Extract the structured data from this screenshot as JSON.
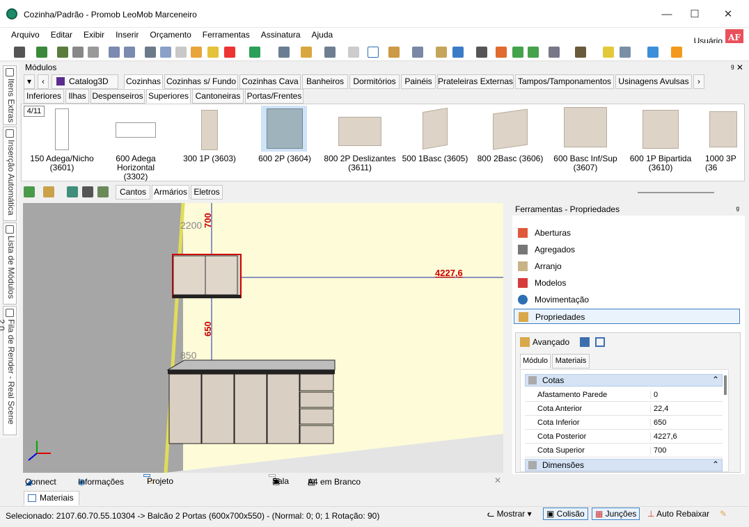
{
  "window": {
    "title": "Cozinha/Padrão - Promob LeoMob Marceneiro",
    "minimize": "—",
    "maximize": "☐",
    "close": "✕"
  },
  "menu": [
    "Arquivo",
    "Editar",
    "Exibir",
    "Inserir",
    "Orçamento",
    "Ferramentas",
    "Assinatura",
    "Ajuda"
  ],
  "user": {
    "label": "Usuário",
    "initials": "AF"
  },
  "left_tabs": [
    "Itens Extras",
    "Inserção Automática",
    "Lista de Módulos",
    "Fila de Render - Real Scene 2.0"
  ],
  "modules_panel": {
    "title": "Módulos",
    "pin": "ᵍ ✕"
  },
  "catalog": {
    "label": "Catalog3D",
    "nav_down": "▾",
    "nav_left": "‹",
    "nav_right": "›"
  },
  "tabs_row1": [
    "Cozinhas",
    "Cozinhas s/ Fundo",
    "Cozinhas Cava",
    "Banheiros",
    "Dormitórios",
    "Painéis",
    "Prateleiras Externas",
    "Tampos/Tamponamentos",
    "Usinagens Avulsas"
  ],
  "tabs_row2": [
    "Inferiores",
    "Ilhas",
    "Despenseiros",
    "Superiores",
    "Cantoneiras",
    "Portas/Frentes"
  ],
  "gallery": {
    "page": "4/11",
    "items": [
      {
        "line1": "150 Adega/Nicho",
        "line2": "(3601)"
      },
      {
        "line1": "600 Adega Horizontal",
        "line2": "(3302)"
      },
      {
        "line1": "300 1P (3603)",
        "line2": ""
      },
      {
        "line1": "600 2P (3604)",
        "line2": ""
      },
      {
        "line1": "800 2P Deslizantes",
        "line2": "(3611)"
      },
      {
        "line1": "500 1Basc (3605)",
        "line2": ""
      },
      {
        "line1": "800 2Basc (3606)",
        "line2": ""
      },
      {
        "line1": "600 Basc Inf/Sup",
        "line2": "(3607)"
      },
      {
        "line1": "600 1P Bipartida",
        "line2": "(3610)"
      },
      {
        "line1": "1000 3P (36",
        "line2": ""
      }
    ]
  },
  "view_tabs": [
    "Cantos",
    "Armários",
    "Eletros"
  ],
  "viewport": {
    "dims": {
      "a": "2200",
      "b": "700",
      "c": "4227,6",
      "d": "650",
      "e": "850"
    }
  },
  "tools_panel": {
    "title": "Ferramentas - Propriedades",
    "pin": "ᵍ",
    "items": [
      "Aberturas",
      "Agregados",
      "Arranjo",
      "Modelos",
      "Movimentação",
      "Propriedades"
    ],
    "advanced": "Avançado",
    "subtabs": [
      "Módulo",
      "Materiais"
    ],
    "cotas": {
      "title": "Cotas",
      "rows": [
        [
          "Afastamento Parede",
          "0"
        ],
        [
          "Cota Anterior",
          "22,4"
        ],
        [
          "Cota Inferior",
          "650"
        ],
        [
          "Cota Posterior",
          "4227,6"
        ],
        [
          "Cota Superior",
          "700"
        ]
      ]
    },
    "dimensoes": "Dimensões"
  },
  "bottom_tabs": {
    "connect": "Connect",
    "info": "Informações",
    "projeto": "Projeto",
    "sala": "Sala",
    "a4": "A4 em Branco",
    "close": "✕"
  },
  "materials_tab": "Materiais",
  "status": {
    "text": "Selecionado: 2107.60.70.55.10304 -> Balcão 2 Portas (600x700x550) - (Normal: 0; 0; 1 Rotação: 90)",
    "mostrar": "Mostrar ▾",
    "colisao": "Colisão",
    "juncoes": "Junções",
    "auto": "Auto Rebaixar"
  }
}
